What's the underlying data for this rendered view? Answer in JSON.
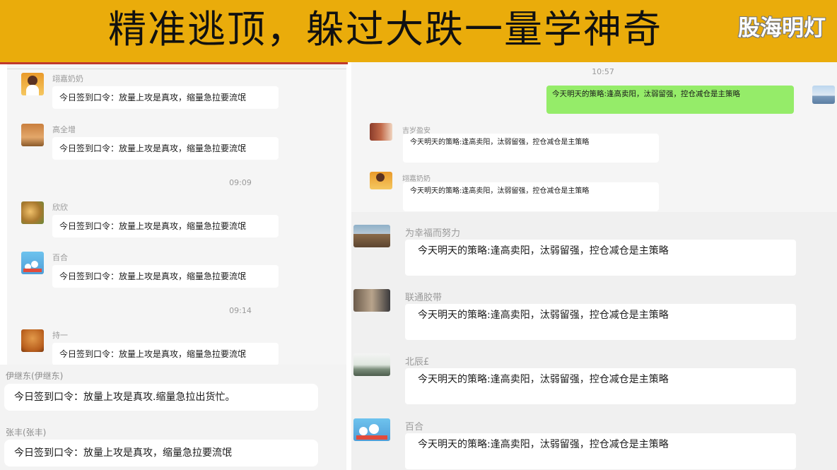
{
  "banner": {
    "title": "精准逃顶，躲过大跌一量学神奇",
    "logo": "股海明灯",
    "color": "#eaac0b"
  },
  "left_chat": {
    "messages_top": [
      {
        "name": "翊嘉奶奶",
        "text": "今日签到口令：放量上攻是真攻，缩量急拉要流氓",
        "avatar": "woman-portrait-icon"
      },
      {
        "name": "高全增",
        "text": "今日签到口令：放量上攻是真攻，缩量急拉要流氓",
        "avatar": "sunset-landscape-icon"
      },
      {
        "time": "09:09"
      },
      {
        "name": "欣欣",
        "text": "今日签到口令：放量上攻是真攻，缩量急拉要流氓",
        "avatar": "flower-photo-icon"
      },
      {
        "name": "百合",
        "text": "今日签到口令：放量上攻是真攻，缩量急拉要流氓",
        "avatar": "lily-flower-icon"
      },
      {
        "time": "09:14"
      },
      {
        "name": "持一",
        "text": "今日签到口令：放量上攻是真攻，缩量急拉要流氓",
        "avatar": "buddha-statue-icon"
      }
    ],
    "messages_bottom": [
      {
        "name": "伊继东(伊继东)",
        "text": "今日签到口令：放量上攻是真攻.缩量急拉出货忙。"
      },
      {
        "name": "张丰(张丰)",
        "text": "今日签到口令：放量上攻是真攻，缩量急拉要流氓"
      }
    ]
  },
  "right_chat": {
    "time": "10:57",
    "self_message": "今天明天的策略:逢高卖阳，汰弱留强，控仓减仓是主策略",
    "small_messages": [
      {
        "name": "吉岁盈安",
        "text": "今天明天的策略:逢高卖阳，汰弱留强，控仓减仓是主策略",
        "avatar": "woman-photo-icon"
      },
      {
        "name": "翊嘉奶奶",
        "text": "今天明天的策略:逢高卖阳，汰弱留强，控仓减仓是主策略",
        "avatar": "woman-portrait-icon"
      }
    ],
    "large_messages": [
      {
        "name": "为幸福而努力",
        "text": "今天明天的策略:逢高卖阳，汰弱留强，控仓减仓是主策略",
        "avatar": "great-wall-icon"
      },
      {
        "name": "联通胶带",
        "text": "今天明天的策略:逢高卖阳，汰弱留强，控仓减仓是主策略",
        "avatar": "man-seated-icon"
      },
      {
        "name": "北辰£",
        "text": "今天明天的策略:逢高卖阳，汰弱留强，控仓减仓是主策略",
        "avatar": "landscape-painting-icon"
      },
      {
        "name": "百合",
        "text": "今天明天的策略:逢高卖阳，汰弱留强，控仓减仓是主策略",
        "avatar": "lily-flower-icon"
      }
    ]
  }
}
